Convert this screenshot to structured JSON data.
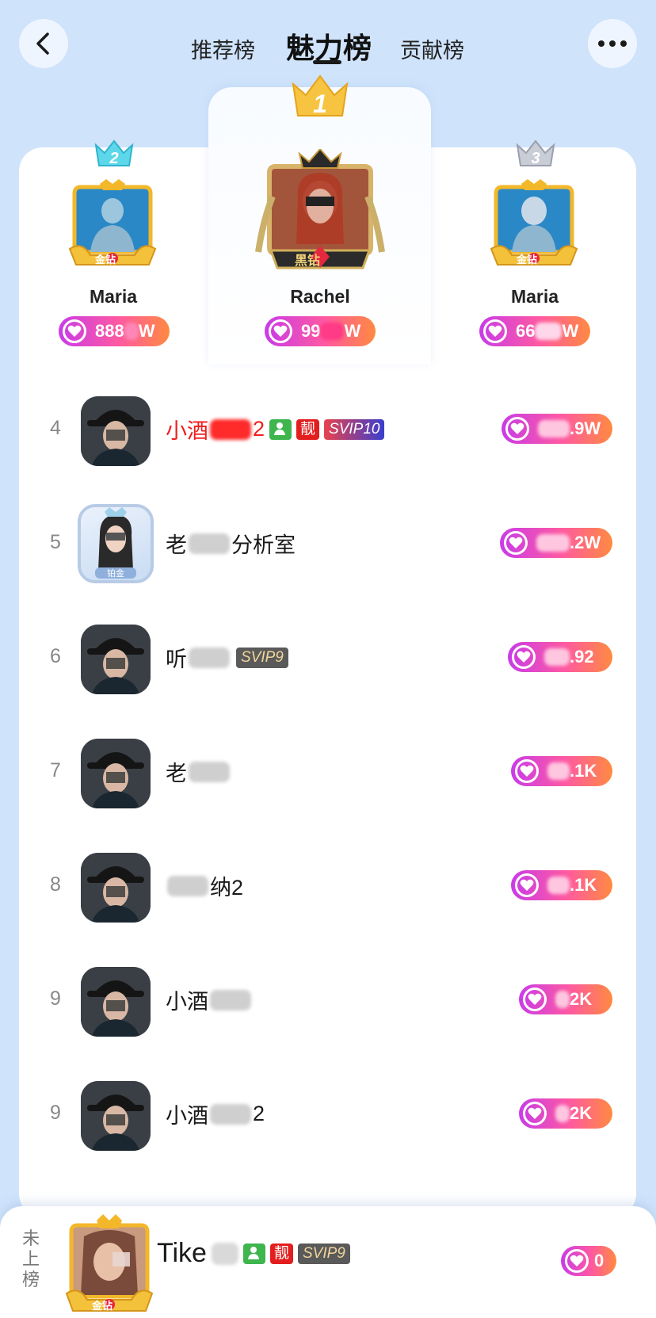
{
  "header": {
    "tabs": [
      {
        "label": "推荐榜"
      },
      {
        "label": "魅力榜"
      },
      {
        "label": "贡献榜"
      }
    ]
  },
  "podium": [
    {
      "rank": "2",
      "name": "Maria",
      "charm": "888",
      "charm_suffix": "W",
      "badge": "金钻"
    },
    {
      "rank": "1",
      "name": "Rachel",
      "charm": "99",
      "charm_suffix": "W",
      "badge": "黑钻"
    },
    {
      "rank": "3",
      "name": "Maria",
      "charm": "66",
      "charm_suffix": "W",
      "badge": "金钻"
    }
  ],
  "list": [
    {
      "rank": "4",
      "name": "小酒",
      "name_tail": "2",
      "name_color": "#f01e1e",
      "badges": [
        "friend",
        "靓",
        "SVIP10"
      ],
      "charm_tail": ".9W"
    },
    {
      "rank": "5",
      "name": "老",
      "name_tail": "分析室",
      "frame": "铂金",
      "badges": [],
      "charm_tail": ".2W"
    },
    {
      "rank": "6",
      "name": "听",
      "name_tail": "",
      "badges": [
        "SVIP9"
      ],
      "charm_tail": ".92"
    },
    {
      "rank": "7",
      "name": "老",
      "name_tail": "",
      "badges": [],
      "charm_tail": ".1K"
    },
    {
      "rank": "8",
      "name": "",
      "name_tail": "纳2",
      "badges": [],
      "charm_tail": ".1K"
    },
    {
      "rank": "9",
      "name": "小酒",
      "name_tail": "",
      "badges": [],
      "charm_tail": "2K"
    },
    {
      "rank": "9",
      "name": "小酒",
      "name_tail": "2",
      "badges": [],
      "charm_tail": "2K"
    }
  ],
  "self": {
    "status_label": "未上榜",
    "name": "Tike",
    "badges": [
      "friend",
      "靓",
      "SVIP9"
    ],
    "charm": "0",
    "avatar_badge": "金钻"
  },
  "colors": {
    "background": "#cfe3fb",
    "pill_start": "#c93be8",
    "pill_end": "#ff8a40",
    "gold": "#f5b62a"
  }
}
